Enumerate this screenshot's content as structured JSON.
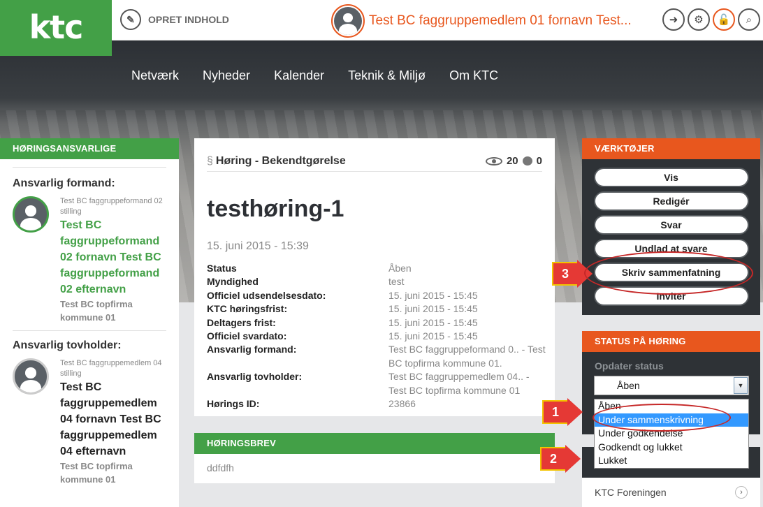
{
  "header": {
    "logo": "ktc",
    "create_label": "OPRET INDHOLD",
    "user_name": "Test BC faggruppemedlem 01 fornavn Test...",
    "icons": [
      "download-icon",
      "gear-icon",
      "lock-icon",
      "search-icon"
    ]
  },
  "nav": [
    "Netværk",
    "Nyheder",
    "Kalender",
    "Teknik & Miljø",
    "Om KTC"
  ],
  "left": {
    "heading": "HØRINGSANSVARLIGE",
    "formand_label": "Ansvarlig formand:",
    "formand": {
      "role": "Test BC faggruppeformand 02 stilling",
      "name": "Test BC faggruppeformand 02 fornavn Test BC faggruppeformand 02 efternavn",
      "org": "Test BC topfirma kommune 01"
    },
    "tovholder_label": "Ansvarlig tovholder:",
    "tovholder": {
      "role": "Test BC faggruppemedlem 04 stilling",
      "name": "Test BC faggruppemedlem 04 fornavn Test BC faggruppemedlem 04 efternavn",
      "org": "Test BC topfirma kommune 01"
    }
  },
  "main": {
    "type_symbol": "§",
    "type": "Høring - Bekendtgørelse",
    "views": "20",
    "comments": "0",
    "title": "testhøring-1",
    "date": "15. juni 2015 - 15:39",
    "details": [
      {
        "k": "Status",
        "v": "Åben"
      },
      {
        "k": "Myndighed",
        "v": "test"
      },
      {
        "k": "Officiel udsendelsesdato:",
        "v": "15. juni 2015 - 15:45"
      },
      {
        "k": "KTC høringsfrist:",
        "v": "15. juni 2015 - 15:45"
      },
      {
        "k": "Deltagers frist:",
        "v": "15. juni 2015 - 15:45"
      },
      {
        "k": "Officiel svardato:",
        "v": "15. juni 2015 - 15:45"
      },
      {
        "k": "Ansvarlig formand:",
        "v": "Test BC faggruppeformand 0.. - Test BC topfirma kommune 01."
      },
      {
        "k": "Ansvarlig tovholder:",
        "v": "Test BC faggruppemedlem 04.. - Test BC topfirma kommune 01"
      },
      {
        "k": "Hørings ID:",
        "v": "23866"
      }
    ],
    "letter_heading": "HØRINGSBREV",
    "letter_body": "ddfdfh"
  },
  "right": {
    "tools_heading": "VÆRKTØJER",
    "tools": [
      "Vis",
      "Redigér",
      "Svar",
      "Undlad at svare",
      "Skriv sammenfatning",
      "Inviter"
    ],
    "status_heading": "STATUS PÅ HØRING",
    "status_label": "Opdater status",
    "status_selected": "Åben",
    "status_options": [
      "Åben",
      "Under sammenskrivning",
      "Under godkendelse",
      "Godkendt og lukket",
      "Lukket"
    ],
    "status_highlighted": "Under sammenskrivning",
    "link": "KTC Foreningen"
  },
  "callouts": [
    "1",
    "2",
    "3"
  ],
  "colors": {
    "green": "#43a047",
    "orange": "#e8571e",
    "dark": "#2e3236",
    "callout": "#e53935"
  }
}
